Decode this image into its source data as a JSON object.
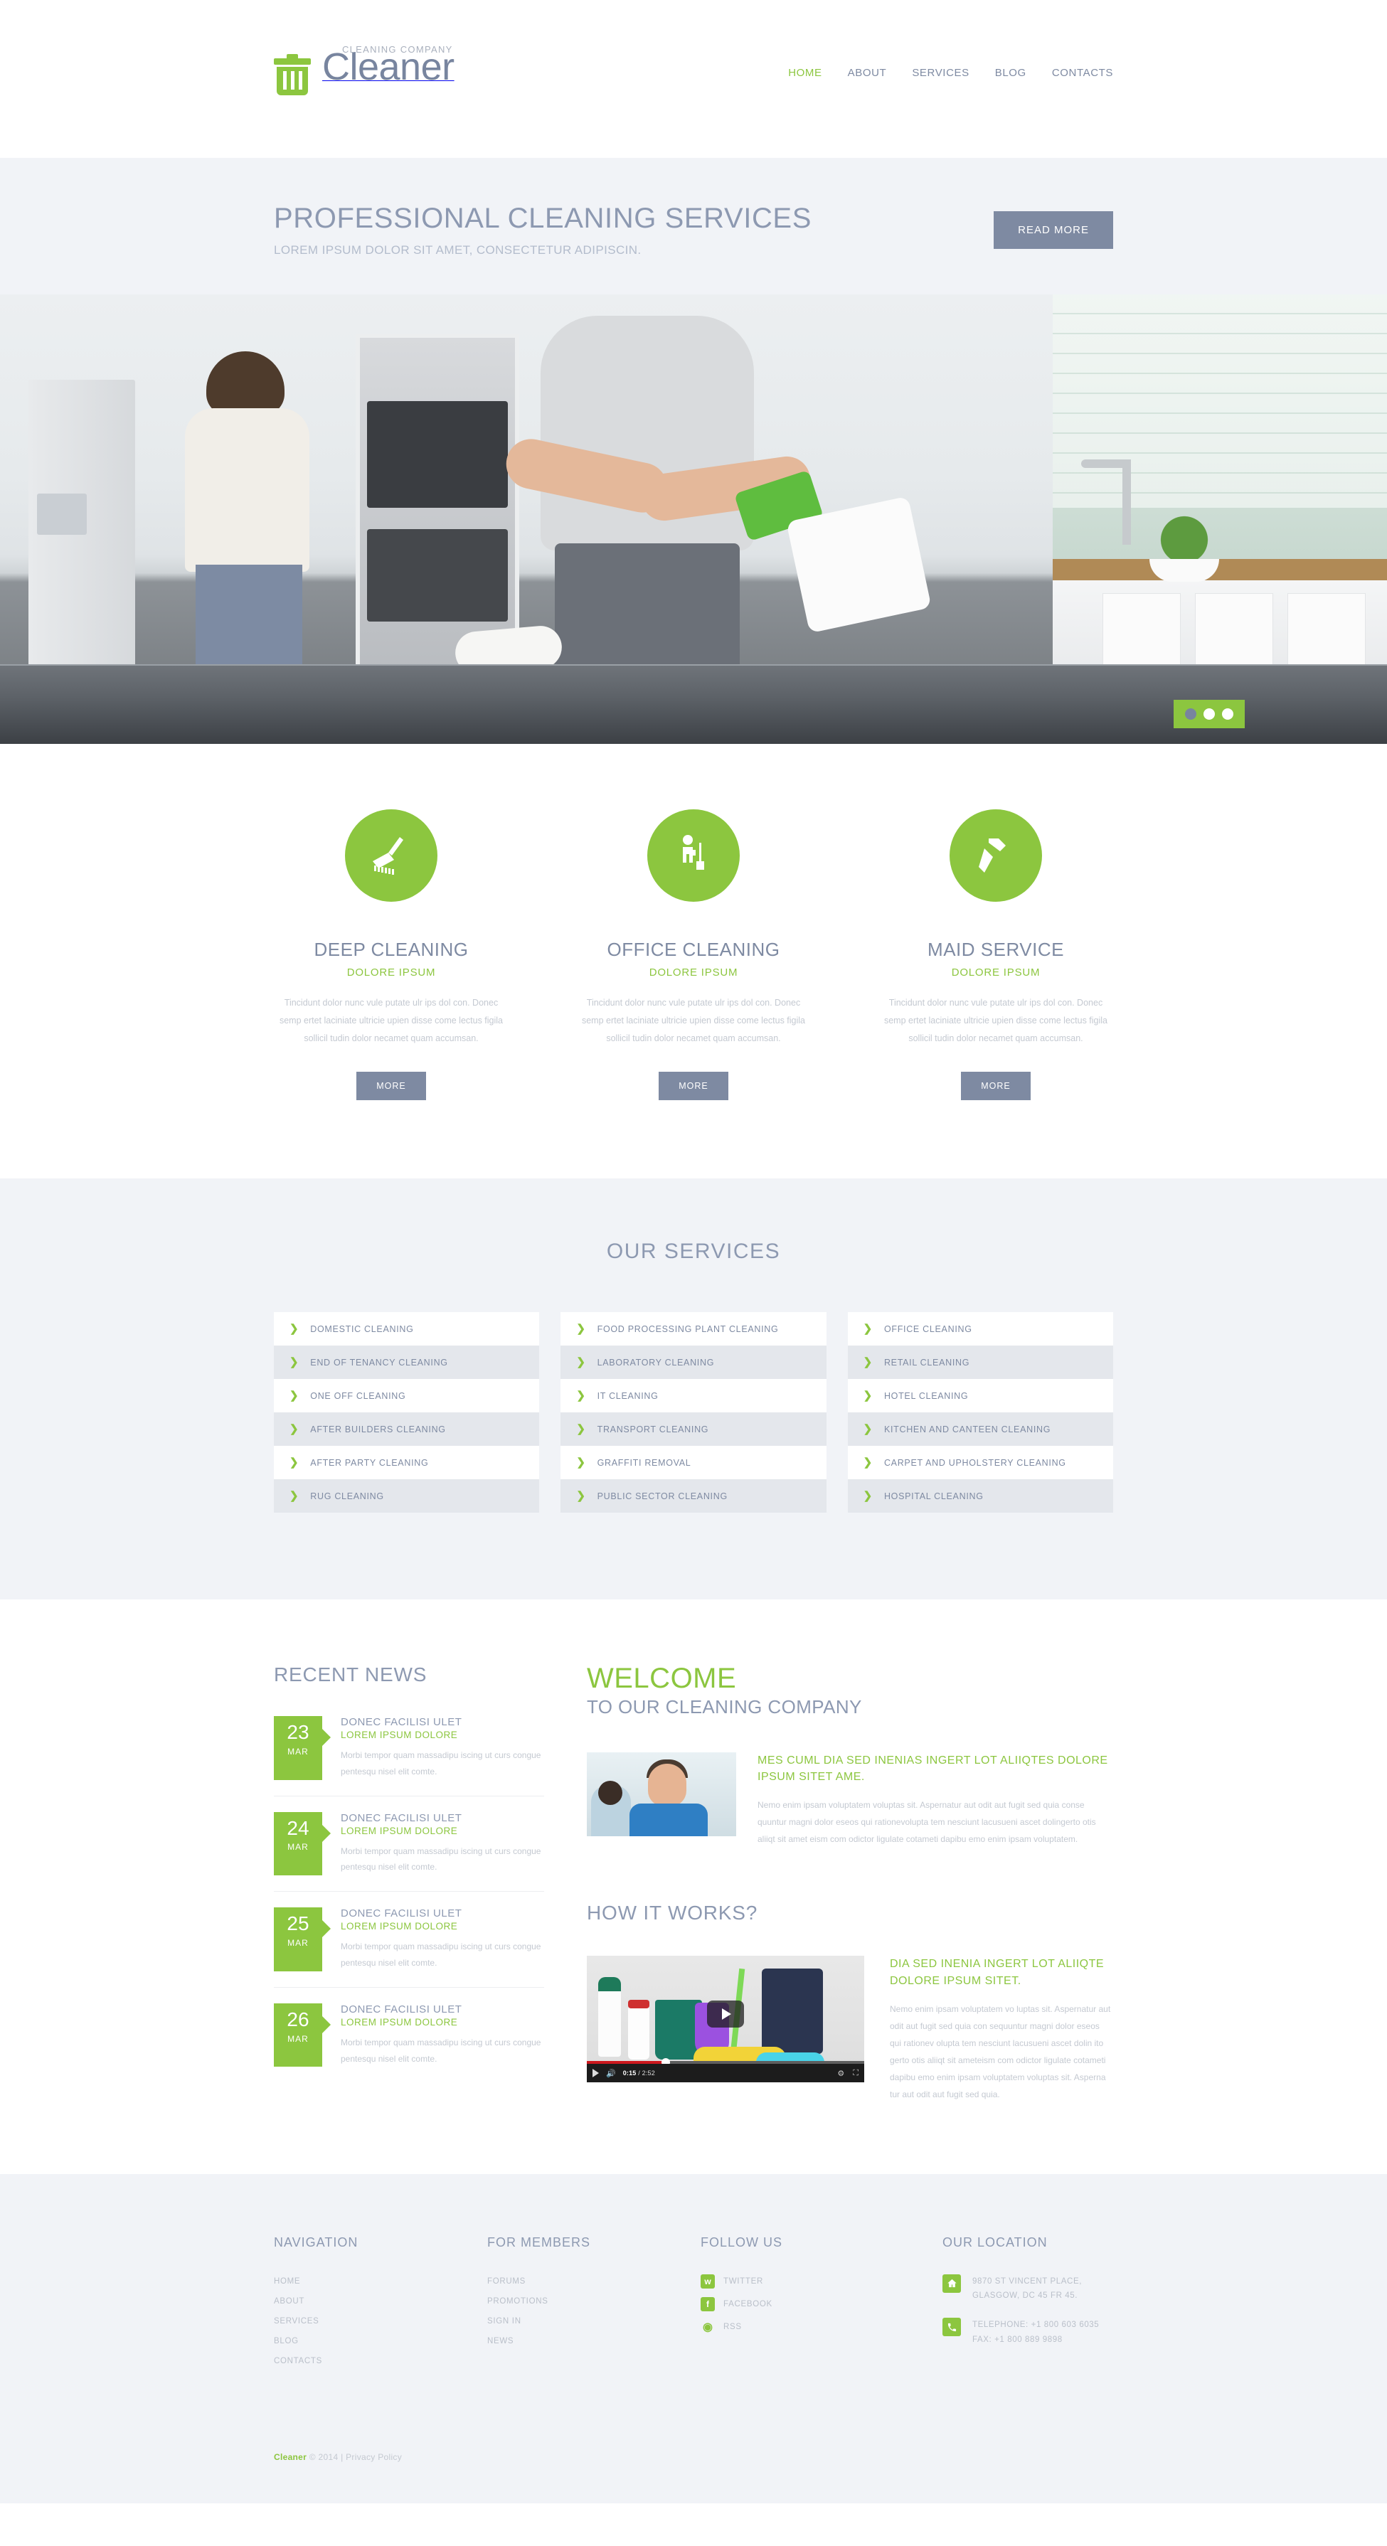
{
  "header": {
    "logo": {
      "tagline": "CLEANING COMPANY",
      "name": "Cleaner",
      "icon": "trash-can-icon"
    },
    "nav": [
      {
        "label": "HOME",
        "active": true
      },
      {
        "label": "ABOUT",
        "active": false
      },
      {
        "label": "SERVICES",
        "active": false
      },
      {
        "label": "BLOG",
        "active": false
      },
      {
        "label": "CONTACTS",
        "active": false
      }
    ]
  },
  "slider": {
    "title": "PROFESSIONAL CLEANING SERVICES",
    "subtitle": "LOREM IPSUM DOLOR SIT AMET, CONSECTETUR ADIPISCIN.",
    "button": "READ MORE",
    "pager": {
      "count": 3,
      "active_index": 0
    }
  },
  "teasers": [
    {
      "icon": "scrub-brush-icon",
      "title": "DEEP CLEANING",
      "subtitle": "DOLORE IPSUM",
      "text": "Tincidunt dolor nunc vule putate ulr ips dol con. Donec semp ertet laciniate ultricie upien disse come lectus figila sollicil tudin dolor necamet quam accumsan.",
      "button": "MORE"
    },
    {
      "icon": "janitor-mop-icon",
      "title": "OFFICE CLEANING",
      "subtitle": "DOLORE IPSUM",
      "text": "Tincidunt dolor nunc vule putate ulr ips dol con. Donec semp ertet laciniate ultricie upien disse come lectus figila sollicil tudin dolor necamet quam accumsan.",
      "button": "MORE"
    },
    {
      "icon": "spray-bottle-icon",
      "title": "MAID SERVICE",
      "subtitle": "DOLORE IPSUM",
      "text": "Tincidunt dolor nunc vule putate ulr ips dol con. Donec semp ertet laciniate ultricie upien disse come lectus figila sollicil tudin dolor necamet quam accumsan.",
      "button": "MORE"
    }
  ],
  "services": {
    "title": "OUR SERVICES",
    "columns": [
      [
        "DOMESTIC CLEANING",
        "END OF TENANCY CLEANING",
        "ONE OFF CLEANING",
        "AFTER BUILDERS CLEANING",
        "AFTER PARTY CLEANING",
        "RUG CLEANING"
      ],
      [
        "FOOD PROCESSING PLANT CLEANING",
        "LABORATORY CLEANING",
        "IT CLEANING",
        "TRANSPORT CLEANING",
        "GRAFFITI REMOVAL",
        "PUBLIC SECTOR CLEANING"
      ],
      [
        "OFFICE CLEANING",
        "RETAIL CLEANING",
        "HOTEL CLEANING",
        "KITCHEN AND CANTEEN CLEANING",
        "CARPET AND UPHOLSTERY CLEANING",
        "HOSPITAL CLEANING"
      ]
    ]
  },
  "news": {
    "title": "RECENT NEWS",
    "items": [
      {
        "day": "23",
        "month": "MAR",
        "title": "DONEC FACILISI ULET",
        "subtitle": "LOREM IPSUM DOLORE",
        "text": "Morbi tempor quam massadipu iscing ut curs congue pentesqu nisel elit comte."
      },
      {
        "day": "24",
        "month": "MAR",
        "title": "DONEC FACILISI ULET",
        "subtitle": "LOREM IPSUM DOLORE",
        "text": "Morbi tempor quam massadipu iscing ut curs congue pentesqu nisel elit comte."
      },
      {
        "day": "25",
        "month": "MAR",
        "title": "DONEC FACILISI ULET",
        "subtitle": "LOREM IPSUM DOLORE",
        "text": "Morbi tempor quam massadipu iscing ut curs congue pentesqu nisel elit comte."
      },
      {
        "day": "26",
        "month": "MAR",
        "title": "DONEC FACILISI ULET",
        "subtitle": "LOREM IPSUM DOLORE",
        "text": "Morbi tempor quam massadipu iscing ut curs congue pentesqu nisel elit comte."
      }
    ]
  },
  "welcome": {
    "title": "WELCOME",
    "subtitle": "TO OUR CLEANING COMPANY",
    "heading": "MES CUML DIA SED INENIAS INGERT LOT ALIIQTES DOLORE IPSUM SITET AME.",
    "text": "Nemo enim ipsam voluptatem voluptas sit. Aspernatur aut odit aut fugit sed quia conse quuntur magni dolor eseos qui rationevolupta tem nesciunt lacusueni ascet dolingerto otis aliiqt sit amet eism com odictor ligulate cotameti dapibu emo enim ipsam voluptatem."
  },
  "how_it_works": {
    "title": "HOW IT WORKS?",
    "heading": "DIA SED INENIA INGERT LOT ALIIQTE DOLORE IPSUM SITET.",
    "text": "Nemo enim ipsam voluptatem vo luptas sit. Aspernatur aut odit aut fugit sed quia con  sequuntur magni dolor eseos qui rationev olupta tem nesciunt lacusueni ascet dolin ito gerto otis aliiqt sit ameteism com odictor ligulate cotameti dapibu emo enim ipsam voluptatem voluptas sit. Asperna tur aut odit aut fugit sed quia.",
    "video": {
      "current_time": "0:15",
      "total_time": "2:52",
      "separator": "/"
    }
  },
  "footer": {
    "navigation": {
      "title": "NAVIGATION",
      "items": [
        "HOME",
        "ABOUT",
        "SERVICES",
        "BLOG",
        "CONTACTS"
      ]
    },
    "members": {
      "title": "FOR MEMBERS",
      "items": [
        "FORUMS",
        "PROMOTIONS",
        "SIGN IN",
        "NEWS"
      ]
    },
    "follow": {
      "title": "FOLLOW US",
      "items": [
        {
          "label": "TWITTER",
          "icon": "twitter-icon"
        },
        {
          "label": "FACEBOOK",
          "icon": "facebook-icon"
        },
        {
          "label": "RSS",
          "icon": "rss-icon"
        }
      ]
    },
    "location": {
      "title": "OUR LOCATION",
      "address_line1": "9870 ST VINCENT PLACE,",
      "address_line2": "GLASGOW, DC 45 FR 45.",
      "phone_line1": "TELEPHONE: +1 800 603 6035",
      "phone_line2": "FAX: +1 800 889 9898",
      "address_icon": "home-icon",
      "phone_icon": "phone-icon"
    },
    "copyright": {
      "brand": "Cleaner",
      "text": " © 2014 | ",
      "privacy": "Privacy Policy"
    }
  },
  "colors": {
    "green": "#8cc63f",
    "slate": "#7e8aa2",
    "light_bg": "#f1f3f7",
    "muted": "#c4c9d1"
  }
}
